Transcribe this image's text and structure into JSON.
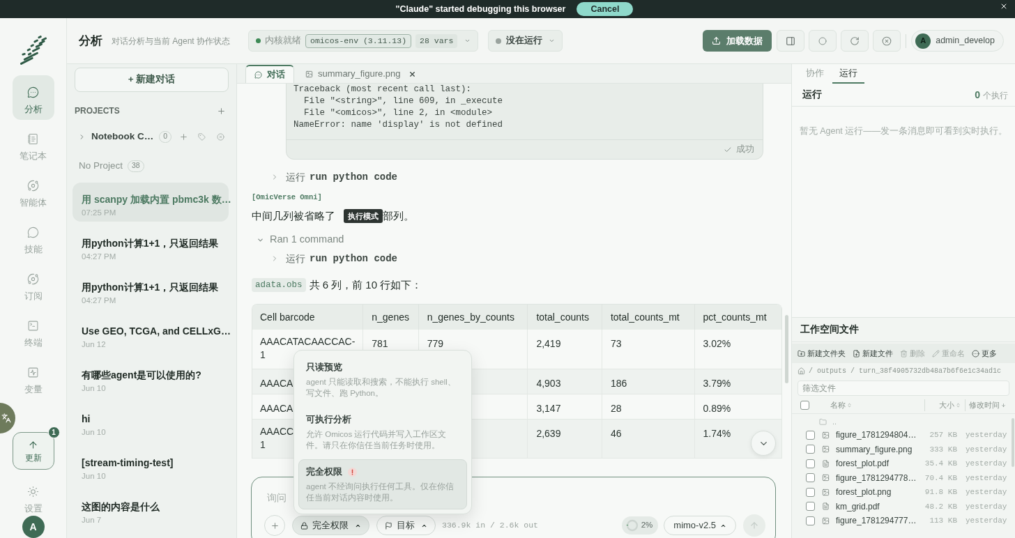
{
  "banner": {
    "text": "\"Claude\" started debugging this browser",
    "cancel": "Cancel"
  },
  "rail": {
    "items": [
      {
        "label": "分析",
        "kind": "chat",
        "selected": true
      },
      {
        "label": "笔记本",
        "kind": "notebook",
        "selected": false
      },
      {
        "label": "智能体",
        "kind": "orbit",
        "selected": false
      },
      {
        "label": "技能",
        "kind": "bubble",
        "selected": false
      },
      {
        "label": "订阅",
        "kind": "orbit",
        "selected": false
      },
      {
        "label": "终端",
        "kind": "terminal",
        "selected": false
      },
      {
        "label": "变量",
        "kind": "chart",
        "selected": false
      }
    ],
    "update": {
      "label": "更新",
      "badge": "1"
    },
    "settings": {
      "label": "设置"
    },
    "avatar": "A"
  },
  "header": {
    "title": "分析",
    "subtitle": "对话分析与当前 Agent 协作状态",
    "kernel": {
      "ready": true,
      "status": "内核就绪",
      "env": "omicos-env (3.11.13)",
      "vars": "28 vars"
    },
    "run": {
      "running": false,
      "status": "没在运行"
    },
    "load_button": "加载数据",
    "user": {
      "avatar": "A",
      "name": "admin_develop"
    }
  },
  "sidebar": {
    "new_chat": "+ 新建对话",
    "projects_heading": "PROJECTS",
    "projects": [
      {
        "name": "Notebook C…",
        "count": "0",
        "expanded": false
      }
    ],
    "no_project": {
      "label": "No Project",
      "count": "38"
    },
    "conversations": [
      {
        "title": "用 scanpy 加载内置 pbmc3k 数…",
        "time": "07:25 PM",
        "selected": true
      },
      {
        "title": "用python计算1+1，只返回结果",
        "time": "04:27 PM",
        "selected": false
      },
      {
        "title": "用python计算1+1，只返回结果",
        "time": "04:27 PM",
        "selected": false
      },
      {
        "title": "Use GEO, TCGA, and CELLxG…",
        "time": "Jun 12",
        "selected": false
      },
      {
        "title": "有哪些agent是可以使用的?",
        "time": "Jun 10",
        "selected": false
      },
      {
        "title": "hi",
        "time": "Jun 10",
        "selected": false
      },
      {
        "title": "[stream-timing-test]",
        "time": "Jun 10",
        "selected": false
      },
      {
        "title": "这图的内容是什么",
        "time": "Jun 7",
        "selected": false
      }
    ]
  },
  "tabs": [
    {
      "label": "对话",
      "kind": "chat",
      "selected": true,
      "closable": false
    },
    {
      "label": "summary_figure.png",
      "kind": "image",
      "selected": false,
      "closable": true
    }
  ],
  "chat": {
    "code_output": {
      "lines": [
        "Traceback (most recent call last):",
        "  File \"<string>\", line 609, in _execute",
        "  File \"<omicos>\", line 2, in <module>",
        "NameError: name 'display' is not defined"
      ],
      "status": "成功",
      "success": true
    },
    "step": {
      "verb": "运行",
      "command": "run python code",
      "expanded": false
    },
    "message": {
      "sender": "[OmicVerse Omni]",
      "text_before": "中间几列被省略了",
      "tooltip": "执行模式",
      "text_after": "部列。"
    },
    "ran": {
      "label": "Ran 1 command",
      "expanded": true,
      "steps": [
        {
          "verb": "运行",
          "command": "run python code",
          "expanded": false
        }
      ]
    },
    "table_intro": {
      "code": "adata.obs",
      "text": "共 6 列，前 10 行如下："
    },
    "table": {
      "columns": [
        "Cell barcode",
        "n_genes",
        "n_genes_by_counts",
        "total_counts",
        "total_counts_mt",
        "pct_counts_mt"
      ],
      "rows": [
        {
          "barcode": [
            "AAACATACAACCAC-",
            "1"
          ],
          "n_genes": "781",
          "n_genes_by_counts": "779",
          "total_counts": "2,419",
          "total_counts_mt": "73",
          "pct_counts_mt": "3.02%"
        },
        {
          "barcode": [
            "AAACA"
          ],
          "total_counts": "4,903",
          "total_counts_mt": "186",
          "pct_counts_mt": "3.79%"
        },
        {
          "barcode": [
            "AAACA"
          ],
          "total_counts": "3,147",
          "total_counts_mt": "28",
          "pct_counts_mt": "0.89%"
        },
        {
          "barcode": [
            "AAACC",
            "1"
          ],
          "total_counts": "2,639",
          "total_counts_mt": "46",
          "pct_counts_mt": "1.74%"
        }
      ]
    }
  },
  "permission_menu": {
    "items": [
      {
        "title": "只读预览",
        "description": "agent 只能读取和搜索，不能执行 shell、写文件、跑 Python。",
        "selected": false,
        "warning": false
      },
      {
        "title": "可执行分析",
        "description": "允许 Omicos 运行代码并写入工作区文件。请只在你信任当前任务时使用。",
        "selected": false,
        "warning": false
      },
      {
        "title": "完全权限",
        "description": "agent 不经询问执行任何工具。仅在你信任当前对话内容时使用。",
        "selected": true,
        "warning": true
      }
    ]
  },
  "composer": {
    "placeholder": "询问",
    "permission": "完全权限",
    "goal": "目标",
    "tokens": "336.9k in / 2.6k out",
    "context": {
      "label": "2%",
      "level": 0.02
    },
    "model": "mimo-v2.5",
    "send_disabled": true
  },
  "right_panel": {
    "tabs": [
      {
        "label": "协作",
        "selected": false
      },
      {
        "label": "运行",
        "selected": true
      }
    ],
    "runs": {
      "title": "运行",
      "count": "0",
      "unit": "个执行",
      "empty": "暂无 Agent 运行——发一条消息即可看到实时执行。"
    }
  },
  "files": {
    "title": "工作空间文件",
    "toolbar": [
      {
        "label": "新建文件夹",
        "kind": "folder",
        "disabled": false
      },
      {
        "label": "新建文件",
        "kind": "file",
        "disabled": false
      },
      {
        "label": "删除",
        "kind": "trash",
        "disabled": true
      },
      {
        "label": "重命名",
        "kind": "pencil",
        "disabled": true
      },
      {
        "label": "更多",
        "kind": "more",
        "disabled": false
      }
    ],
    "path": "/ outputs / turn_38f4905732db48a7b6f6e1c34ad1c",
    "filter_placeholder": "筛选文件",
    "select_all_checked": false,
    "columns": [
      {
        "label": "名称",
        "sorted": false
      },
      {
        "label": "大小",
        "sorted": false
      },
      {
        "label": "修改时间",
        "sorted": true
      }
    ],
    "parent": "..",
    "items": [
      {
        "name": "figure_1781294804…",
        "kind": "image",
        "size": "257 KB",
        "modified": "yesterday",
        "checked": false
      },
      {
        "name": "summary_figure.png",
        "kind": "image",
        "size": "333 KB",
        "modified": "yesterday",
        "checked": false
      },
      {
        "name": "forest_plot.pdf",
        "kind": "pdf",
        "size": "35.4 KB",
        "modified": "yesterday",
        "checked": false
      },
      {
        "name": "figure_1781294778…",
        "kind": "image",
        "size": "70.4 KB",
        "modified": "yesterday",
        "checked": false
      },
      {
        "name": "forest_plot.png",
        "kind": "image",
        "size": "91.8 KB",
        "modified": "yesterday",
        "checked": false
      },
      {
        "name": "km_grid.pdf",
        "kind": "pdf",
        "size": "48.2 KB",
        "modified": "yesterday",
        "checked": false
      },
      {
        "name": "figure_1781294777…",
        "kind": "image",
        "size": "113 KB",
        "modified": "yesterday",
        "checked": false
      }
    ]
  }
}
